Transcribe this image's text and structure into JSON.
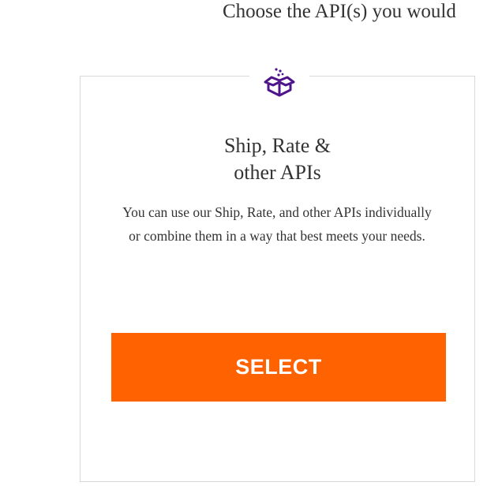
{
  "page": {
    "heading": "Choose the API(s) you would"
  },
  "card": {
    "icon": "box-icon",
    "title": "Ship, Rate &\nother APIs",
    "description": "You can use our Ship, Rate, and other APIs individually or combine them in a way that best meets your needs.",
    "select_label": "SELECT"
  },
  "colors": {
    "accent_orange": "#ff6200",
    "icon_purple": "#4d148c",
    "text": "#333333",
    "card_border": "#d9d9d9"
  }
}
